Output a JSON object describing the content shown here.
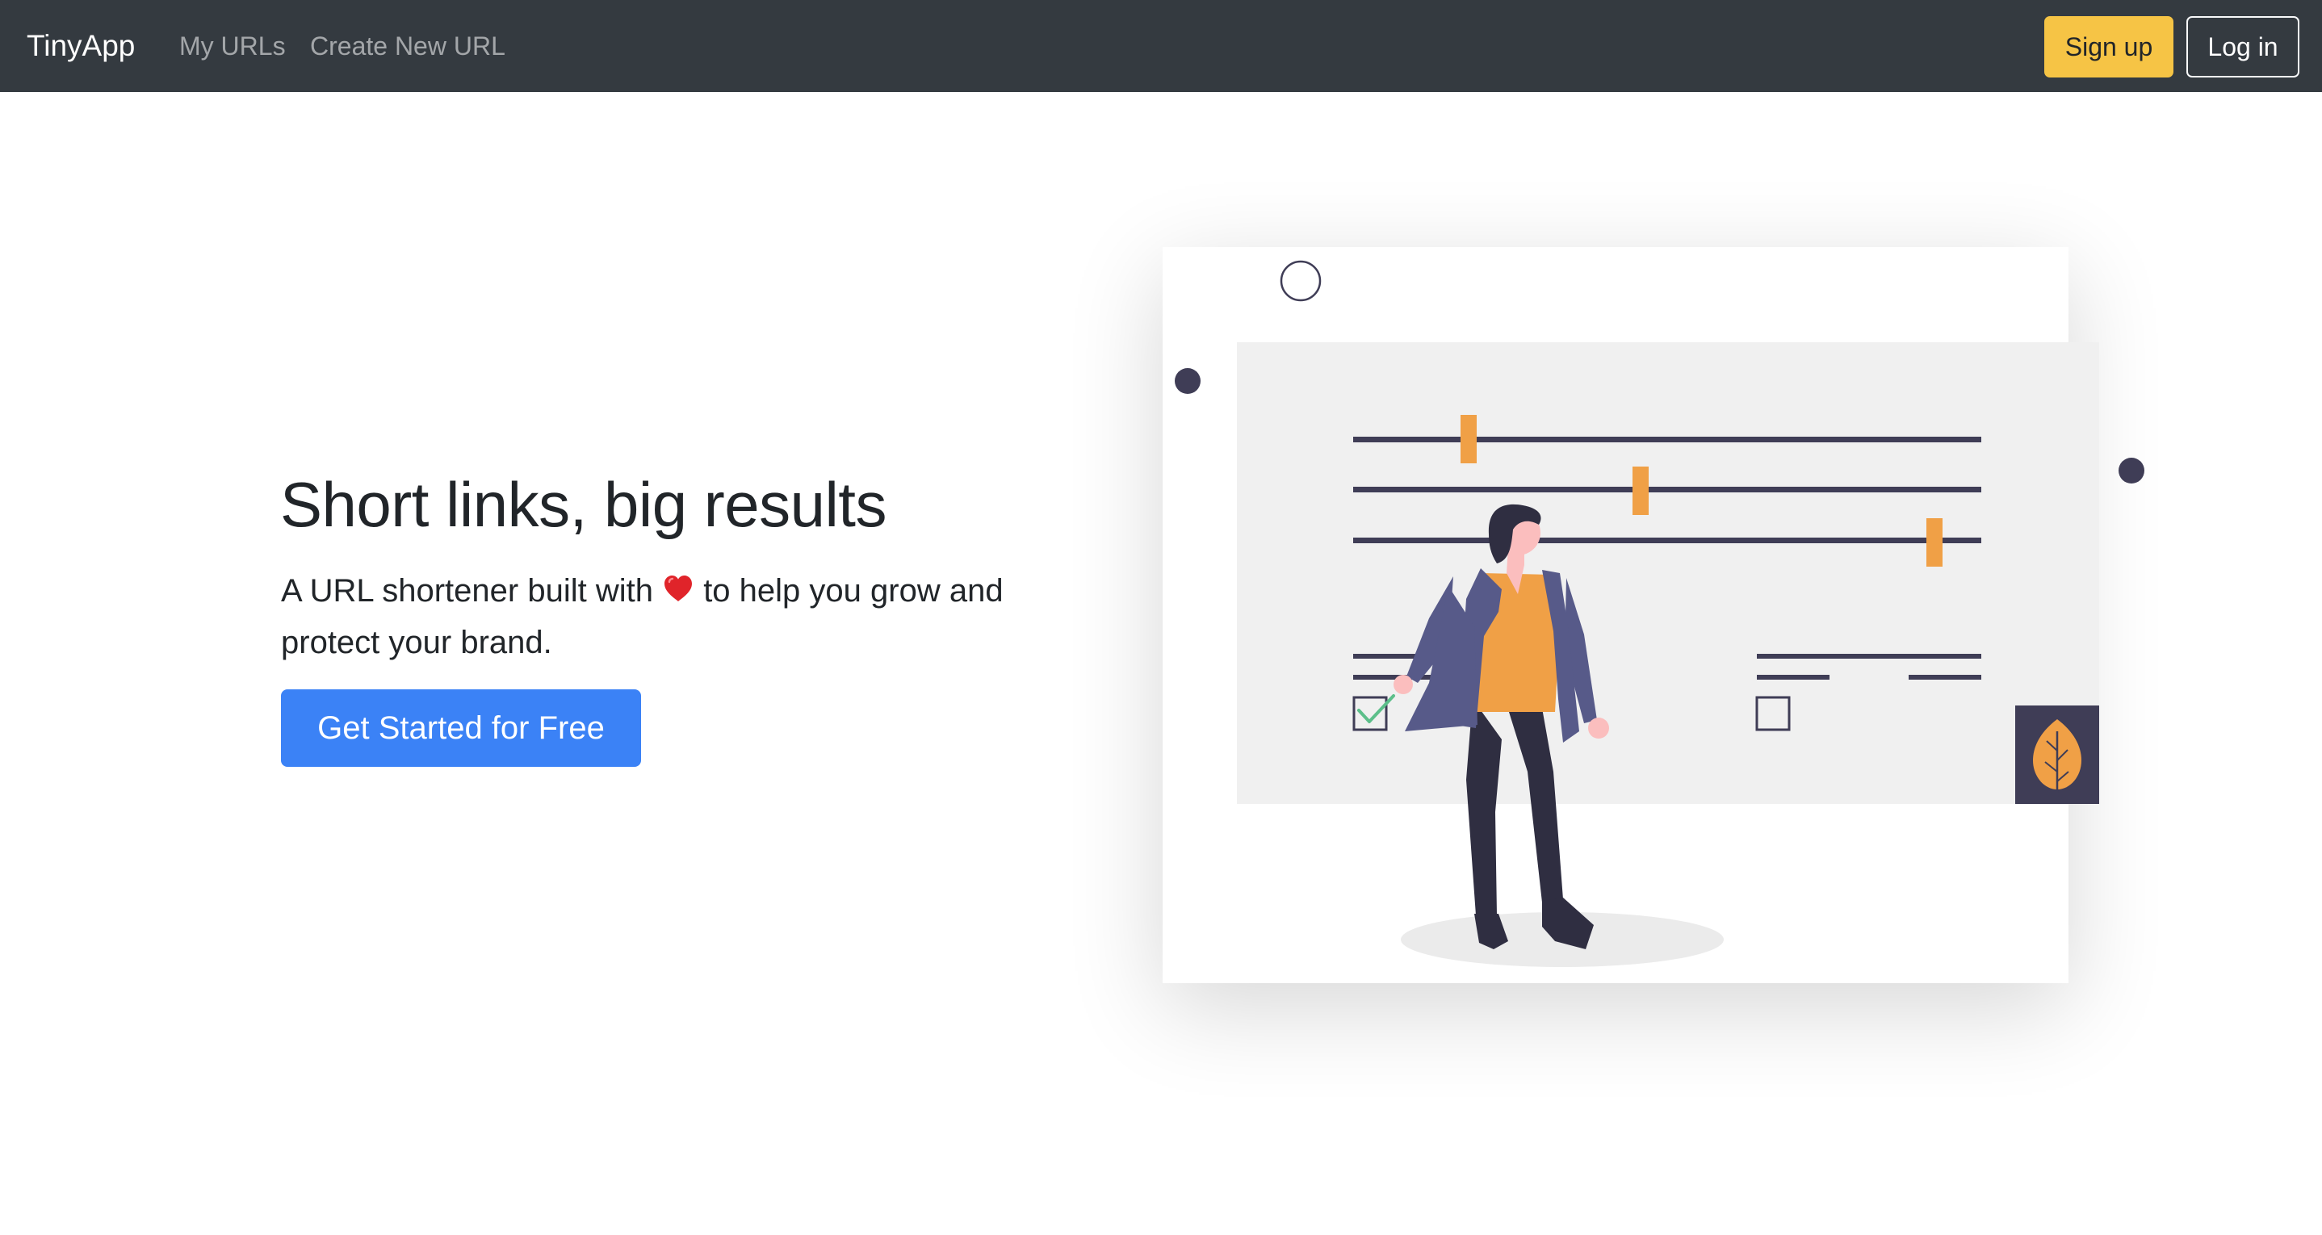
{
  "navbar": {
    "brand": "TinyApp",
    "links": [
      {
        "label": "My URLs"
      },
      {
        "label": "Create New URL"
      }
    ],
    "signup_label": "Sign up",
    "login_label": "Log in"
  },
  "hero": {
    "title": "Short links, big results",
    "lead_before": "A URL shortener built with ",
    "heart_icon": "heart-icon",
    "lead_after": " to help you grow and protect your brand.",
    "cta_label": "Get Started for Free"
  },
  "colors": {
    "navbar_bg": "#343a40",
    "signup_bg": "#f6c445",
    "primary": "#3b82f6",
    "illustration_accent": "#f0a046",
    "illustration_dark": "#3f3d56"
  },
  "illustration": {
    "icons": [
      "checked-box-icon",
      "empty-box-icon",
      "leaf-icon",
      "circle-icon"
    ]
  }
}
